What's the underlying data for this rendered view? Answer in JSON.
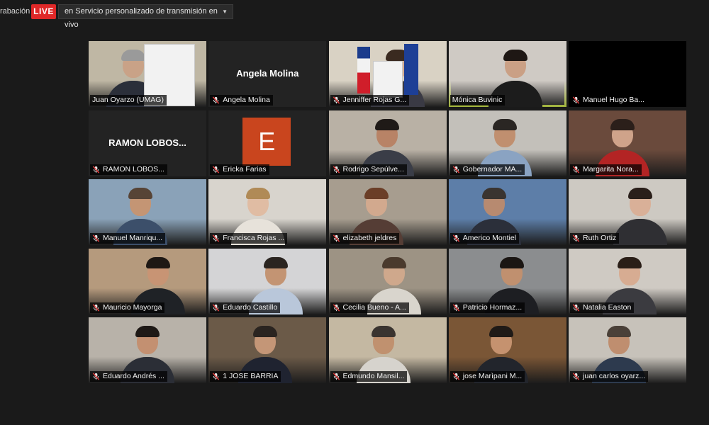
{
  "toolbar": {
    "recording_label": "rabación",
    "live_label": "LIVE",
    "stream_selector": "en Servicio personalizado de transmisión en vivo",
    "caret_icon": "chevron-down-icon"
  },
  "participants": [
    {
      "name": "Juan Oyarzo (UMAG)",
      "type": "video",
      "bg": "#bfb7a4",
      "skin": "#c9a287",
      "shirt": "#2b2f3a",
      "hair": "#9a9a9a",
      "muted": false
    },
    {
      "name": "Angela Molina",
      "type": "name_only",
      "label": "Angela Molina",
      "muted": true
    },
    {
      "name": "Jenniffer Rojas G...",
      "type": "video",
      "bg": "#d9d2c4",
      "skin": "#d7ad91",
      "shirt": "#3a3a44",
      "hair": "#3a2a20",
      "muted": true
    },
    {
      "name": "Mónica Buvinic",
      "type": "video",
      "bg": "#cfcac4",
      "skin": "#caa085",
      "shirt": "#1c1c1c",
      "hair": "#1e1714",
      "muted": false,
      "active": true
    },
    {
      "name": "Manuel Hugo Ba...",
      "type": "blank",
      "muted": true
    },
    {
      "name": "RAMON  LOBOS...",
      "type": "name_only",
      "label": "RAMON  LOBOS...",
      "muted": true
    },
    {
      "name": "Ericka Farias",
      "type": "avatar",
      "initial": "E",
      "muted": true
    },
    {
      "name": "Rodrigo Sepúlve...",
      "type": "video",
      "bg": "#b9b1a5",
      "skin": "#b88366",
      "shirt": "#3a3d47",
      "hair": "#1f1a17",
      "muted": true
    },
    {
      "name": "Gobernador MA...",
      "type": "video",
      "bg": "#c3c0ba",
      "skin": "#c08f6f",
      "shirt": "#8aa3c2",
      "hair": "#2a2623",
      "muted": true
    },
    {
      "name": "Margarita Nora...",
      "type": "video",
      "bg": "#6a4a3c",
      "skin": "#cfa38a",
      "shirt": "#b32424",
      "hair": "#2b1f1a",
      "muted": true
    },
    {
      "name": "Manuel Manriqu...",
      "type": "video",
      "bg": "#8aa2b8",
      "skin": "#c49574",
      "shirt": "#3c4f6a",
      "hair": "#574436",
      "muted": true
    },
    {
      "name": "Francisca Rojas ...",
      "type": "video",
      "bg": "#d8d4cd",
      "skin": "#e0bca3",
      "shirt": "#e7e2da",
      "hair": "#b08a56",
      "muted": true
    },
    {
      "name": "elizabeth jeldres",
      "type": "video",
      "bg": "#a79d8f",
      "skin": "#d2a98e",
      "shirt": "#553d35",
      "hair": "#6b3e27",
      "muted": true
    },
    {
      "name": "Americo Montiel",
      "type": "video",
      "bg": "#5d7ea8",
      "skin": "#b78a70",
      "shirt": "#2b2f3a",
      "hair": "#3a3430",
      "muted": true
    },
    {
      "name": "Ruth Ortiz",
      "type": "video",
      "bg": "#cdc9c2",
      "skin": "#d9b098",
      "shirt": "#2f2f33",
      "hair": "#2a1f1a",
      "muted": true
    },
    {
      "name": "Mauricio Mayorga",
      "type": "video",
      "bg": "#b59a7d",
      "skin": "#c89474",
      "shirt": "#1f2226",
      "hair": "#1e1814",
      "muted": true
    },
    {
      "name": "Eduardo Castillo",
      "type": "video",
      "bg": "#d4d4d6",
      "skin": "#c39473",
      "shirt": "#b9c7da",
      "hair": "#2a2420",
      "muted": true
    },
    {
      "name": "Cecilia Bueno - A...",
      "type": "video",
      "bg": "#9d9384",
      "skin": "#cfa88c",
      "shirt": "#d9d5cd",
      "hair": "#4a3a2d",
      "muted": true
    },
    {
      "name": "Patricio Hormaz...",
      "type": "video",
      "bg": "#8b8d8f",
      "skin": "#c0906f",
      "shirt": "#1d1e22",
      "hair": "#1b1613",
      "muted": true
    },
    {
      "name": "Natalia Easton",
      "type": "video",
      "bg": "#cfcac3",
      "skin": "#d7ac92",
      "shirt": "#3b3b40",
      "hair": "#2a1e17",
      "muted": true
    },
    {
      "name": "Eduardo Andrés ...",
      "type": "video",
      "bg": "#b8b2a9",
      "skin": "#c39071",
      "shirt": "#2b2e36",
      "hair": "#1e1916",
      "muted": true
    },
    {
      "name": "1 JOSE BARRIA",
      "type": "video",
      "bg": "#6b5a48",
      "skin": "#c49677",
      "shirt": "#1f2330",
      "hair": "#2a2420",
      "muted": true
    },
    {
      "name": "Edmundo Mansil...",
      "type": "video",
      "bg": "#c4b8a2",
      "skin": "#c0916f",
      "shirt": "#d6d3cd",
      "hair": "#3a3430",
      "muted": true
    },
    {
      "name": "jose Marìpani M...",
      "type": "video",
      "bg": "#7a5636",
      "skin": "#c5926f",
      "shirt": "#22252c",
      "hair": "#1f1a17",
      "muted": true
    },
    {
      "name": "juan carlos oyarz...",
      "type": "video",
      "bg": "#c7c2ba",
      "skin": "#bf8e6f",
      "shirt": "#2d3a4e",
      "hair": "#4a4038",
      "muted": true
    }
  ]
}
